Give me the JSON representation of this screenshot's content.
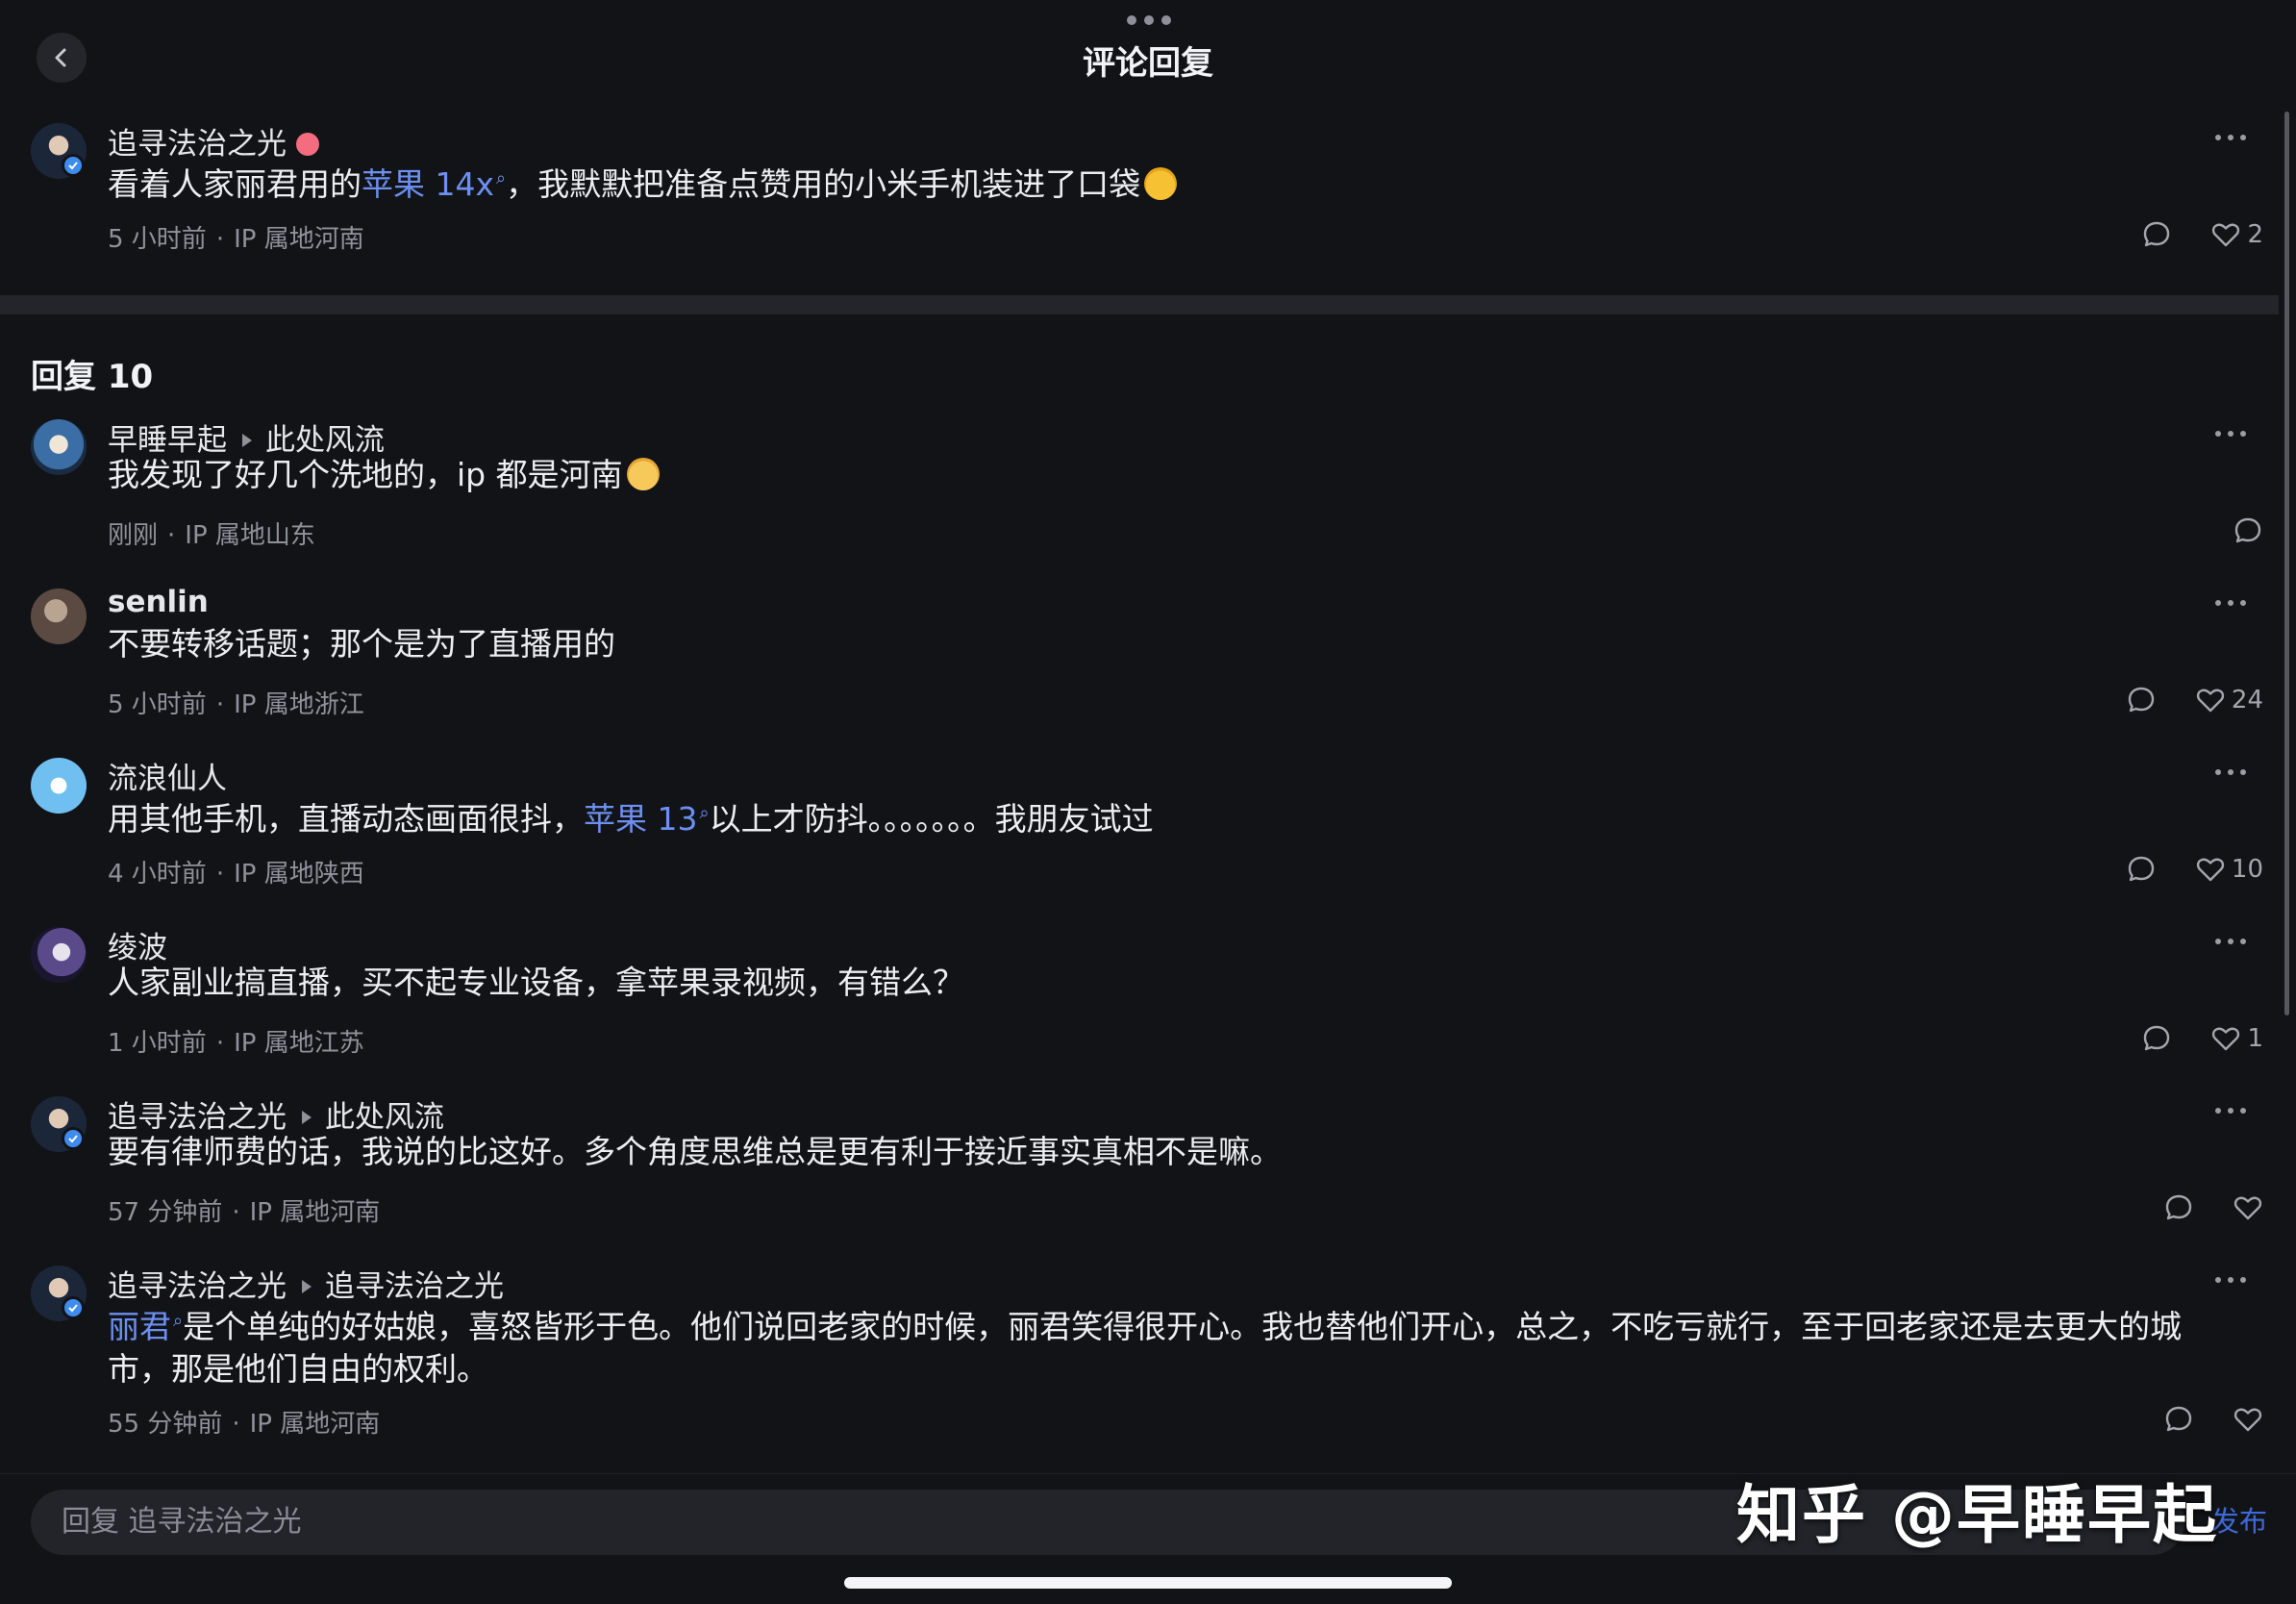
{
  "header": {
    "title": "评论回复"
  },
  "parent": {
    "name": "追寻法治之光",
    "text_before": "看着人家丽君用的",
    "link": "苹果 14x",
    "text_after": "，我默默把准备点赞用的小米手机装进了口袋",
    "time": "5 小时前",
    "ip": "IP 属地河南",
    "likes": "2"
  },
  "reply_section": {
    "label": "回复 10"
  },
  "replies": [
    {
      "name": "早睡早起",
      "reply_to": "此处风流",
      "text": "我发现了好几个洗地的，ip 都是河南",
      "time": "刚刚",
      "ip": "IP 属地山东",
      "likes": ""
    },
    {
      "name": "senlin",
      "text": "不要转移话题；那个是为了直播用的",
      "time": "5 小时前",
      "ip": "IP 属地浙江",
      "likes": "24"
    },
    {
      "name": "流浪仙人",
      "text_before": "用其他手机，直播动态画面很抖，",
      "link": "苹果 13",
      "text_after": "以上才防抖。。。。。。。我朋友试过",
      "time": "4 小时前",
      "ip": "IP 属地陕西",
      "likes": "10"
    },
    {
      "name": "绫波",
      "text": "人家副业搞直播，买不起专业设备，拿苹果录视频，有错么？",
      "time": "1 小时前",
      "ip": "IP 属地江苏",
      "likes": "1"
    },
    {
      "name": "追寻法治之光",
      "reply_to": "此处风流",
      "text": "要有律师费的话，我说的比这好。多个角度思维总是更有利于接近事实真相不是嘛。",
      "time": "57 分钟前",
      "ip": "IP 属地河南",
      "likes": ""
    },
    {
      "name": "追寻法治之光",
      "reply_to": "追寻法治之光",
      "link": "丽君",
      "text_after": "是个单纯的好姑娘，喜怒皆形于色。他们说回老家的时候，丽君笑得很开心。我也替他们开心，总之，不吃亏就行，至于回老家还是去更大的城市，那是他们自由的权利。",
      "time": "55 分钟前",
      "ip": "IP 属地河南",
      "likes": ""
    }
  ],
  "composer": {
    "placeholder": "回复 追寻法治之光",
    "publish": "发布"
  },
  "watermark": "知乎 @早睡早起",
  "icons": {
    "back": "chevron-left-icon",
    "more": "more-horizontal-icon",
    "comment": "comment-bubble-icon",
    "like": "heart-outline-icon"
  },
  "colors": {
    "background": "#121317",
    "link": "#6c8ff0",
    "verified": "#3f8cf0",
    "publish": "#3d6ad8"
  }
}
